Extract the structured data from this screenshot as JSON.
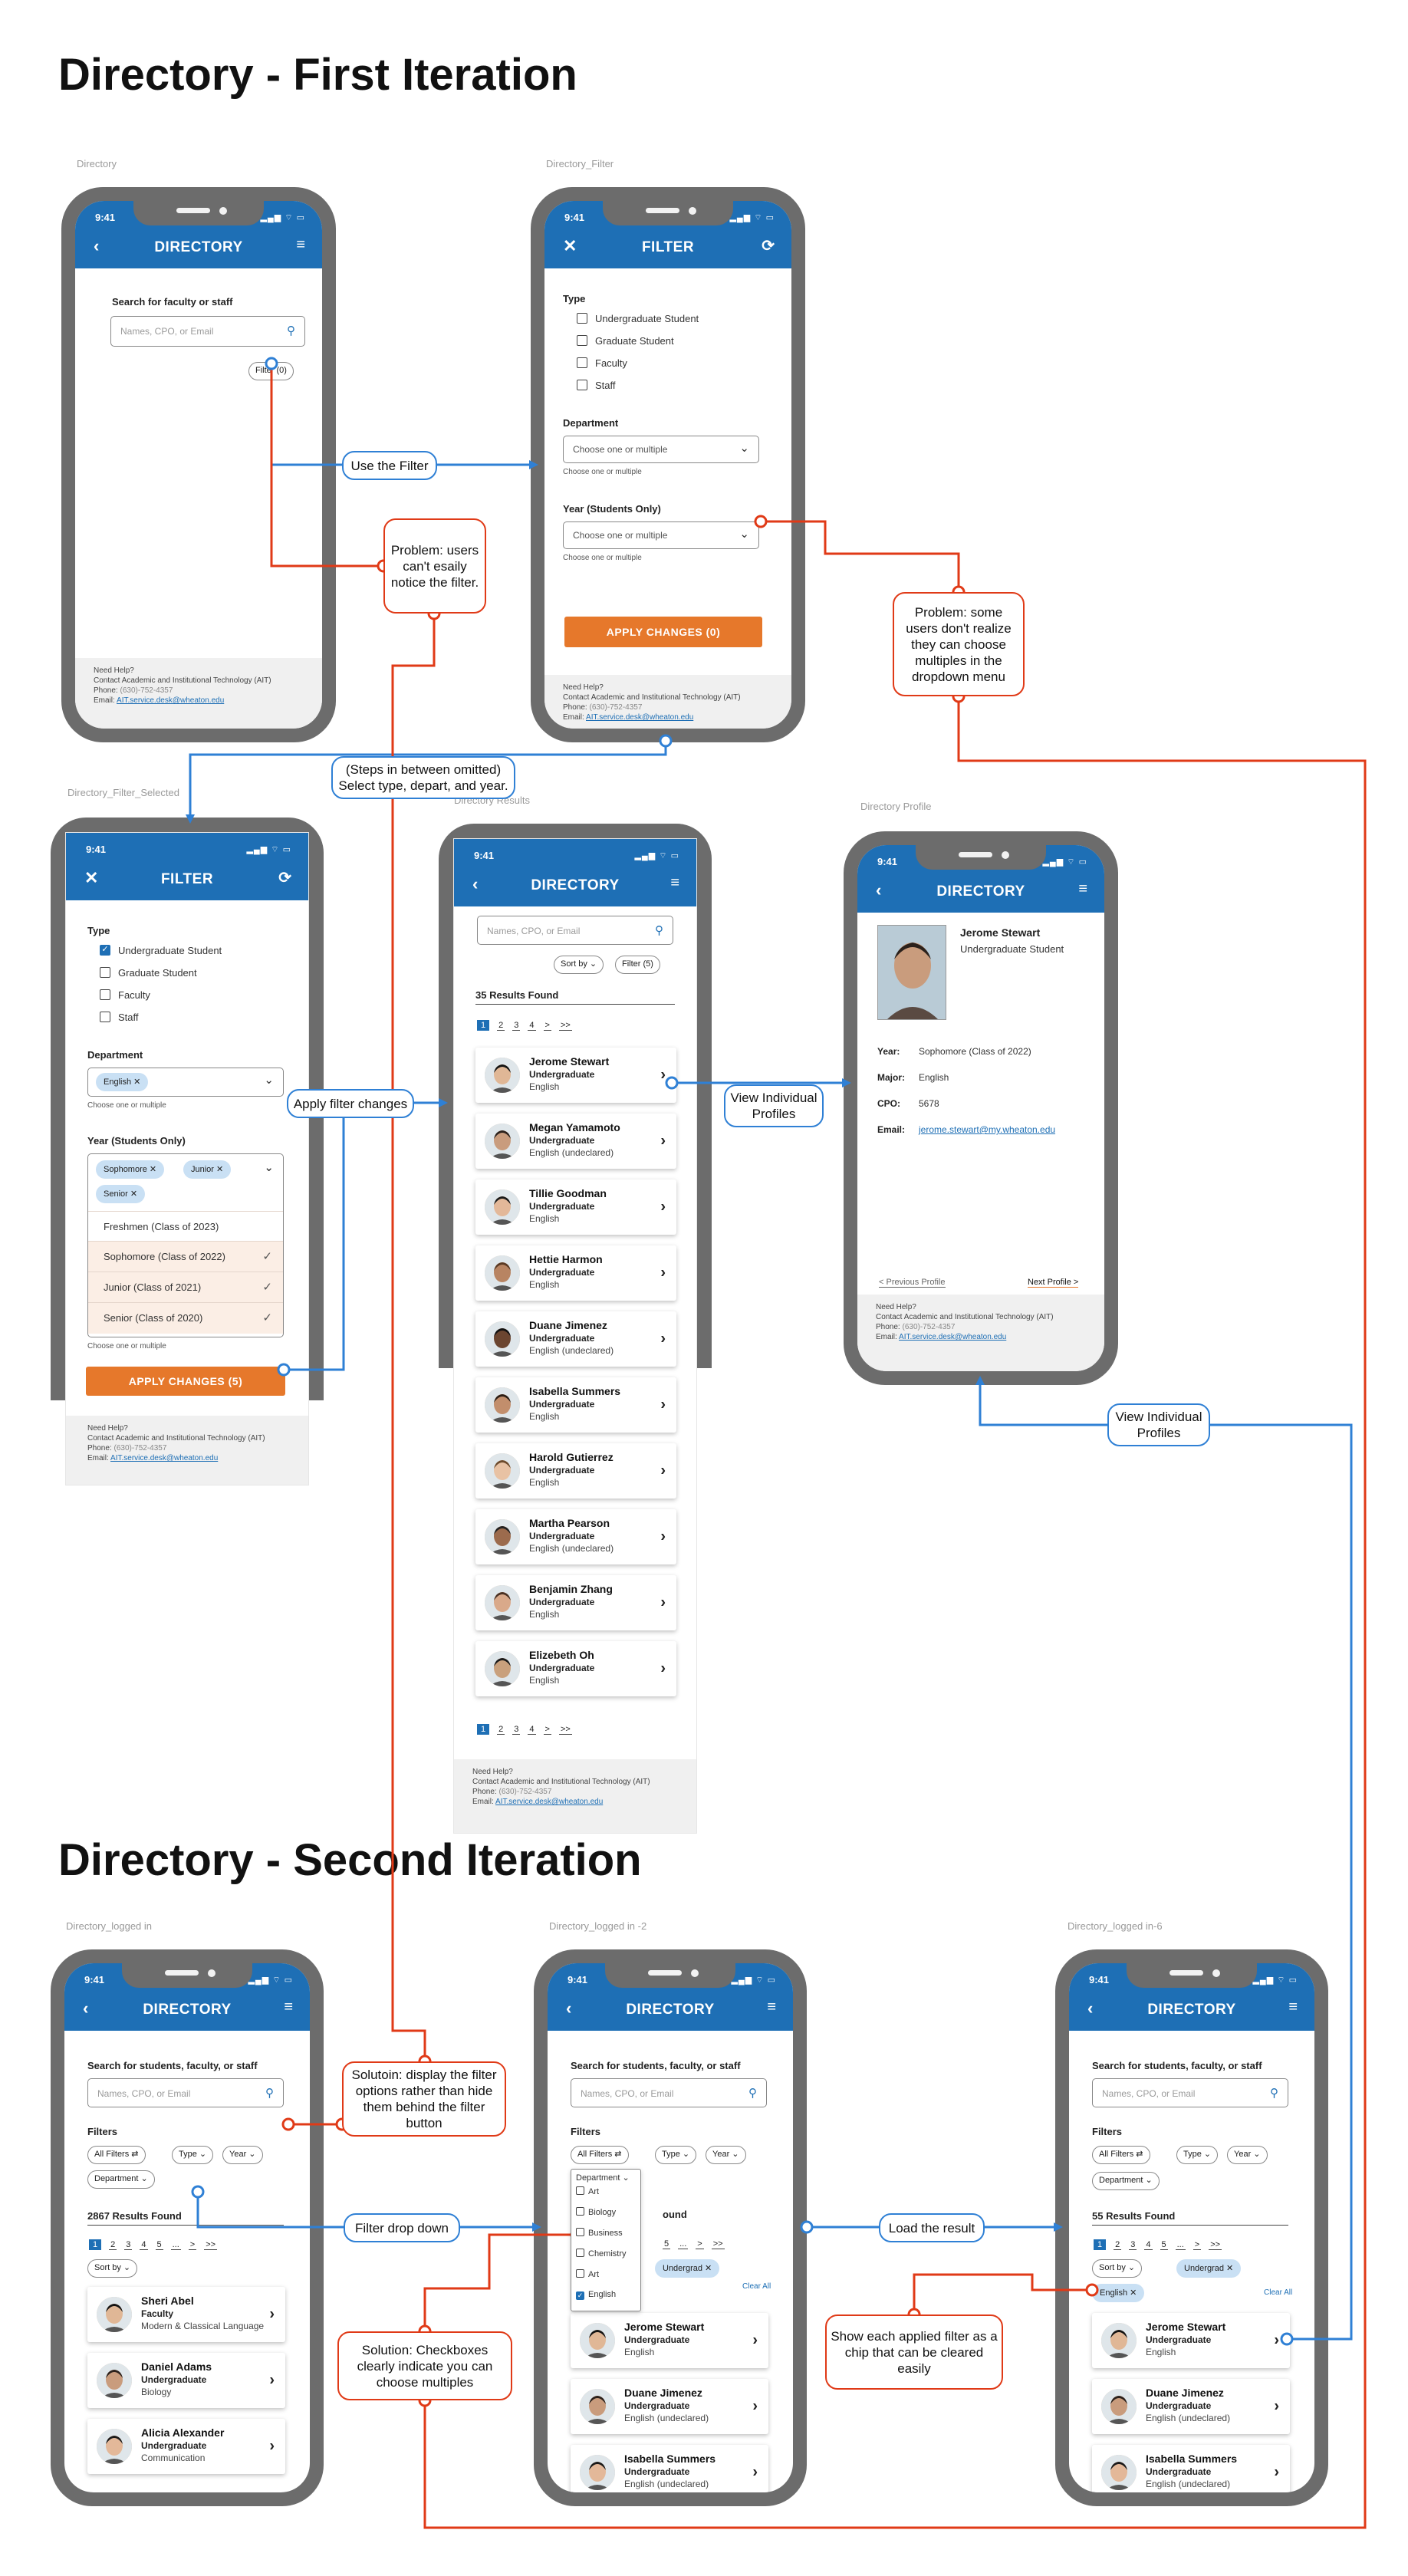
{
  "sections": {
    "first": "Directory - First Iteration",
    "second": "Directory - Second Iteration"
  },
  "captions": {
    "c1": "Directory",
    "c2": "Directory_Filter",
    "c3": "Directory_Filter_Selected",
    "c4": "Directory Results",
    "c5": "Directory Profile",
    "c6": "Directory_logged in",
    "c7": "Directory_logged in -2",
    "c8": "Directory_logged in-6"
  },
  "status": {
    "time": "9:41",
    "icons": "▂▄▆ ⌔ ▭"
  },
  "titles": {
    "directory": "DIRECTORY",
    "filter": "FILTER"
  },
  "footer": {
    "need": "Need Help?",
    "contact": "Contact Academic and Institutional Technology (AIT)",
    "phone_label": "Phone:",
    "phone": "(630)-752-4357",
    "email_label": "Email:",
    "email": "AIT.service.desk@wheaton.edu"
  },
  "s1": {
    "search_label": "Search for faculty or staff",
    "placeholder": "Names, CPO, or Email",
    "filter_btn": "Filter (0)"
  },
  "s2": {
    "type": "Type",
    "types": [
      "Undergraduate Student",
      "Graduate Student",
      "Faculty",
      "Staff"
    ],
    "department": "Department",
    "choose": "Choose one or multiple",
    "hint": "Choose one or multiple",
    "year": "Year (Students Only)",
    "apply": "APPLY CHANGES (0)"
  },
  "s3": {
    "apply": "APPLY CHANGES (5)",
    "dept_chip": "English",
    "year_chips": [
      "Sophomore",
      "Junior",
      "Senior"
    ],
    "years": [
      "Freshmen (Class of 2023)",
      "Sophomore (Class of 2022)",
      "Junior (Class of 2021)",
      "Senior (Class of 2020)"
    ]
  },
  "s4": {
    "placeholder": "Names, CPO, or Email",
    "sort": "Sort by",
    "filter": "Filter (5)",
    "found": "35 Results Found",
    "pages": [
      "1",
      "2",
      "3",
      "4",
      ">",
      ">>"
    ],
    "people": [
      {
        "name": "Jerome Stewart",
        "level": "Undergraduate",
        "major": "English"
      },
      {
        "name": "Megan Yamamoto",
        "level": "Undergraduate",
        "major": "English (undeclared)"
      },
      {
        "name": "Tillie Goodman",
        "level": "Undergraduate",
        "major": "English"
      },
      {
        "name": "Hettie Harmon",
        "level": "Undergraduate",
        "major": "English"
      },
      {
        "name": "Duane Jimenez",
        "level": "Undergraduate",
        "major": "English (undeclared)"
      },
      {
        "name": "Isabella Summers",
        "level": "Undergraduate",
        "major": "English"
      },
      {
        "name": "Harold Gutierrez",
        "level": "Undergraduate",
        "major": "English"
      },
      {
        "name": "Martha Pearson",
        "level": "Undergraduate",
        "major": "English (undeclared)"
      },
      {
        "name": "Benjamin Zhang",
        "level": "Undergraduate",
        "major": "English"
      },
      {
        "name": "Elizebeth Oh",
        "level": "Undergraduate",
        "major": "English"
      }
    ]
  },
  "s5": {
    "name": "Jerome Stewart",
    "level": "Undergraduate Student",
    "year_l": "Year:",
    "year": "Sophomore (Class of 2022)",
    "major_l": "Major:",
    "major": "English",
    "cpo_l": "CPO:",
    "cpo": "5678",
    "email_l": "Email:",
    "email": "jerome.stewart@my.wheaton.edu",
    "prev": "< Previous Profile",
    "next": "Next Profile >"
  },
  "s6": {
    "search_label": "Search for students, faculty, or staff",
    "placeholder": "Names, CPO, or Email",
    "filters": "Filters",
    "all": "All Filters ⇄",
    "type": "Type ⌄",
    "year": "Year ⌄",
    "dept": "Department ⌄",
    "found": "2867 Results Found",
    "pages": [
      "1",
      "2",
      "3",
      "4",
      "5",
      "...",
      ">",
      ">>"
    ],
    "sort": "Sort by ⌄",
    "people": [
      {
        "name": "Sheri Abel",
        "level": "Faculty",
        "major": "Modern & Classical Language"
      },
      {
        "name": "Daniel Adams",
        "level": "Undergraduate",
        "major": "Biology"
      },
      {
        "name": "Alicia Alexander",
        "level": "Undergraduate",
        "major": "Communication"
      }
    ]
  },
  "s7": {
    "dept_head": "Department ⌄",
    "depts": [
      "Art",
      "Biology",
      "Business",
      "Chemistry",
      "Art",
      "English"
    ],
    "found_tail": "ound",
    "chip": "Undergrad",
    "clear": "Clear All",
    "people": [
      {
        "name": "Jerome Stewart",
        "level": "Undergraduate",
        "major": "English"
      },
      {
        "name": "Duane Jimenez",
        "level": "Undergraduate",
        "major": "English (undeclared)"
      },
      {
        "name": "Isabella Summers",
        "level": "Undergraduate",
        "major": "English (undeclared)"
      }
    ]
  },
  "s8": {
    "found": "55 Results Found",
    "chip_year": "Undergrad",
    "chip_eng": "English",
    "clear": "Clear All"
  },
  "notes": {
    "use_filter": "Use the Filter",
    "prob1": "Problem: users can't esaily notice the filter.",
    "prob2": "Problem: some users don't realize they can choose multiples in the dropdown menu",
    "steps": "(Steps in between omitted) Select type, depart, and year.",
    "apply": "Apply filter changes",
    "view1": "View Individual Profiles",
    "view2": "View Individual Profiles",
    "sol1": "Solutoin: display the filter options rather than hide them behind the filter button",
    "dropdown": "Filter drop down",
    "load": "Load the result",
    "sol2": "Solution: Checkboxes clearly indicate you can choose multiples",
    "chipnote": "Show each applied filter as a chip that can be cleared easily"
  },
  "colors": {
    "brand": "#1e6fb5",
    "accent": "#e6782b",
    "problem": "#e03a17",
    "flow": "#2f80d5"
  }
}
